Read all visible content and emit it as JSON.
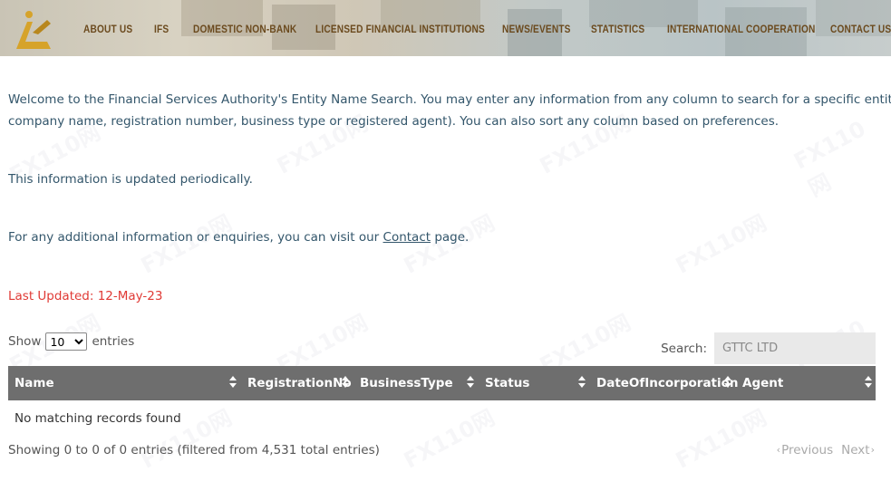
{
  "nav": {
    "items": [
      "ABOUT US",
      "IFS",
      "DOMESTIC NON-BANK",
      "LICENSED FINANCIAL INSTITUTIONS",
      "NEWS/EVENTS",
      "STATISTICS",
      "INTERNATIONAL COOPERATION",
      "CONTACT US"
    ]
  },
  "intro": {
    "line1": "Welcome to the Financial Services Authority's Entity Name Search. You may enter any information from any column to search for a specific entity (i.e.",
    "line2": "company name, registration number, business type or registered agent). You can also sort any column based on preferences.",
    "updated_note": "This information is updated periodically.",
    "enquiry_prefix": "For any additional information or enquiries, you can visit our",
    "enquiry_link": "Contact",
    "enquiry_suffix": "page."
  },
  "last_updated": "Last Updated:  12-May-23",
  "length_menu": {
    "prefix": "Show",
    "selected": "10",
    "suffix": "entries"
  },
  "search": {
    "label": "Search:",
    "value": "GTTC LTD"
  },
  "table": {
    "columns": [
      "Name",
      "RegistrationNo",
      "BusinessType",
      "Status",
      "DateOfIncorporation",
      "Agent"
    ],
    "empty_message": "No matching records found"
  },
  "footer": {
    "info": "Showing 0 to 0 of 0 entries (filtered from 4,531 total entries)",
    "previous": "Previous",
    "next": "Next"
  },
  "watermark_text": "FX110网",
  "colors": {
    "nav_text": "#6b4a1e",
    "body_text": "#33566b",
    "last_updated": "#e03a35",
    "table_header_bg": "#6e6e6e",
    "search_bg": "#e9e9e9",
    "logo_gold": "#d6a32a"
  }
}
